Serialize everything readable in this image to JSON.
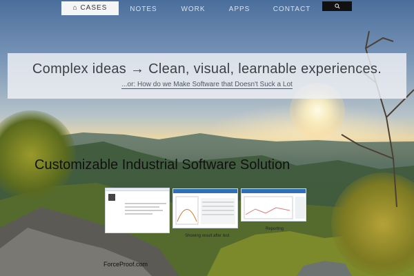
{
  "nav": {
    "items": [
      {
        "id": "cases",
        "label": "⌂ CASES",
        "active": true
      },
      {
        "id": "notes",
        "label": "NOTES",
        "active": false
      },
      {
        "id": "work",
        "label": "WORK",
        "active": false
      },
      {
        "id": "apps",
        "label": "APPS",
        "active": false
      },
      {
        "id": "contact",
        "label": "CONTACT",
        "active": false
      }
    ],
    "search_icon": "search-icon"
  },
  "banner": {
    "title": "Complex ideas → Clean, visual, learnable experiences.",
    "subtitle": "...or: How do we Make Software that Doesn't Suck a Lot"
  },
  "project": {
    "title": "Customizable Industrial Software Solution",
    "thumbnails": [
      {
        "caption": ""
      },
      {
        "caption": "Showing result after test"
      },
      {
        "caption": "Reporting"
      }
    ],
    "footer_link": "ForceProof.com"
  }
}
